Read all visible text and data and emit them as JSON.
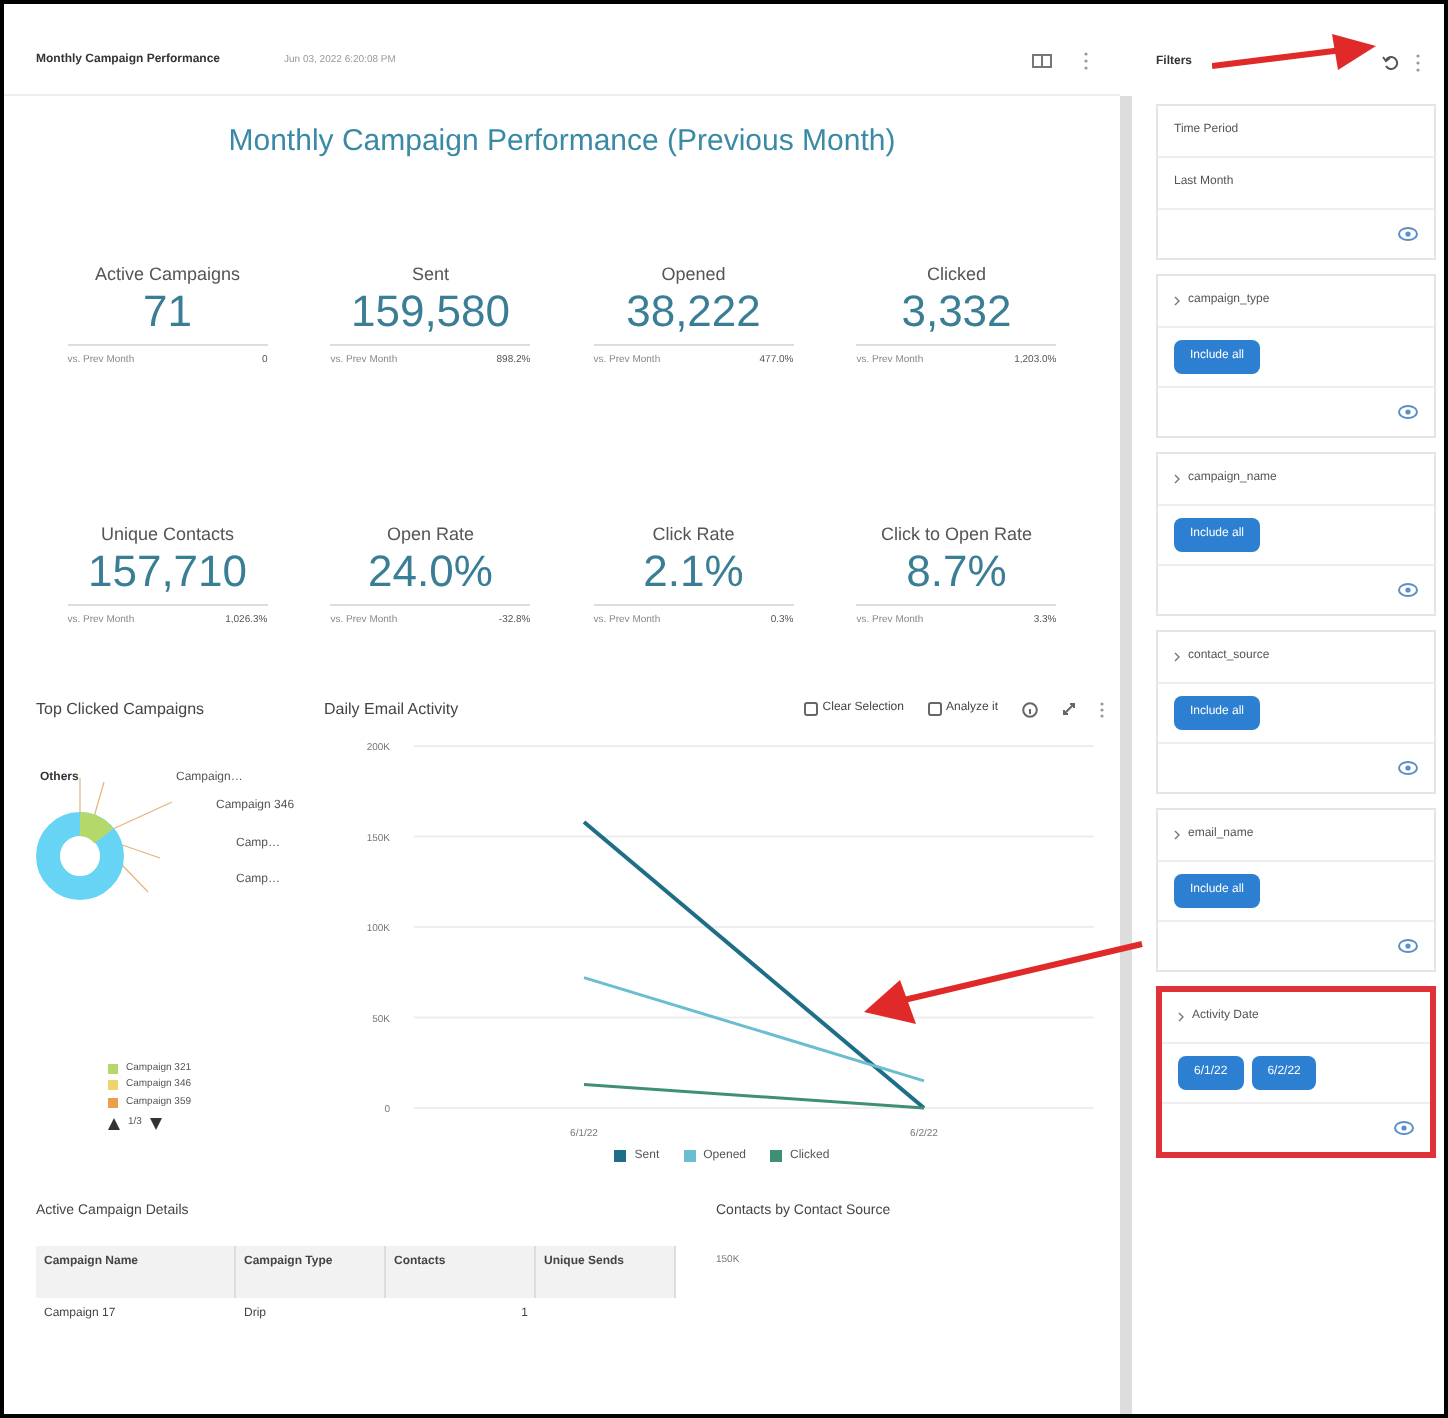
{
  "header": {
    "title": "Monthly Campaign Performance",
    "timestamp": "Jun 03, 2022 6:20:08 PM"
  },
  "dashboard_title": "Monthly Campaign Performance (Previous Month)",
  "kpis": [
    {
      "label": "Active Campaigns",
      "value": "71",
      "compare_label": "vs. Prev Month",
      "compare_value": "0"
    },
    {
      "label": "Sent",
      "value": "159,580",
      "compare_label": "vs. Prev Month",
      "compare_value": "898.2%"
    },
    {
      "label": "Opened",
      "value": "38,222",
      "compare_label": "vs. Prev Month",
      "compare_value": "477.0%"
    },
    {
      "label": "Clicked",
      "value": "3,332",
      "compare_label": "vs. Prev Month",
      "compare_value": "1,203.0%"
    },
    {
      "label": "Unique Contacts",
      "value": "157,710",
      "compare_label": "vs. Prev Month",
      "compare_value": "1,026.3%"
    },
    {
      "label": "Open Rate",
      "value": "24.0%",
      "compare_label": "vs. Prev Month",
      "compare_value": "-32.8%"
    },
    {
      "label": "Click Rate",
      "value": "2.1%",
      "compare_label": "vs. Prev Month",
      "compare_value": "0.3%"
    },
    {
      "label": "Click to Open Rate",
      "value": "8.7%",
      "compare_label": "vs. Prev Month",
      "compare_value": "3.3%"
    }
  ],
  "top_clicked": {
    "title": "Top Clicked Campaigns",
    "slice_labels": [
      "Others",
      "Campaign…",
      "Campaign 346",
      "Camp…",
      "Camp…"
    ],
    "legend": [
      {
        "label": "Campaign 321",
        "color": "#b5d86a"
      },
      {
        "label": "Campaign 346",
        "color": "#f2d36b"
      },
      {
        "label": "Campaign 359",
        "color": "#e8a04a"
      }
    ],
    "pager": "1/3"
  },
  "daily_activity": {
    "title": "Daily Email Activity",
    "actions": [
      "Clear Selection",
      "Analyze it"
    ],
    "chart_data": {
      "type": "line",
      "grid": true,
      "categories": [
        "6/1/22",
        "6/2/22"
      ],
      "ylim": [
        0,
        200000
      ],
      "yticks": [
        {
          "value": 0,
          "label": "0"
        },
        {
          "value": 50000,
          "label": "50K"
        },
        {
          "value": 100000,
          "label": "100K"
        },
        {
          "value": 150000,
          "label": "150K"
        },
        {
          "value": 200000,
          "label": "200K"
        }
      ],
      "series": [
        {
          "name": "Sent",
          "color": "#1f6e87",
          "values": [
            158000,
            0
          ]
        },
        {
          "name": "Opened",
          "color": "#6bbdd0",
          "values": [
            72000,
            15000
          ]
        },
        {
          "name": "Clicked",
          "color": "#3f8f73",
          "values": [
            13000,
            0
          ]
        }
      ]
    }
  },
  "campaign_details": {
    "title": "Active Campaign Details",
    "columns": [
      "Campaign Name",
      "Campaign Type",
      "Contacts",
      "Unique Sends"
    ],
    "rows": [
      [
        "Campaign 17",
        "Drip",
        "1",
        ""
      ]
    ]
  },
  "contacts_by_source": {
    "title": "Contacts by Contact Source",
    "ytick": "150K"
  },
  "filters": {
    "title": "Filters",
    "time_period": {
      "label": "Time Period",
      "value": "Last Month"
    },
    "items": [
      {
        "name": "campaign_type",
        "values": [
          "Include all"
        ],
        "highlighted": false
      },
      {
        "name": "campaign_name",
        "values": [
          "Include all"
        ],
        "highlighted": false
      },
      {
        "name": "contact_source",
        "values": [
          "Include all"
        ],
        "highlighted": false
      },
      {
        "name": "email_name",
        "values": [
          "Include all"
        ],
        "highlighted": false
      },
      {
        "name": "Activity Date",
        "values": [
          "6/1/22",
          "6/2/22"
        ],
        "highlighted": true
      }
    ]
  }
}
